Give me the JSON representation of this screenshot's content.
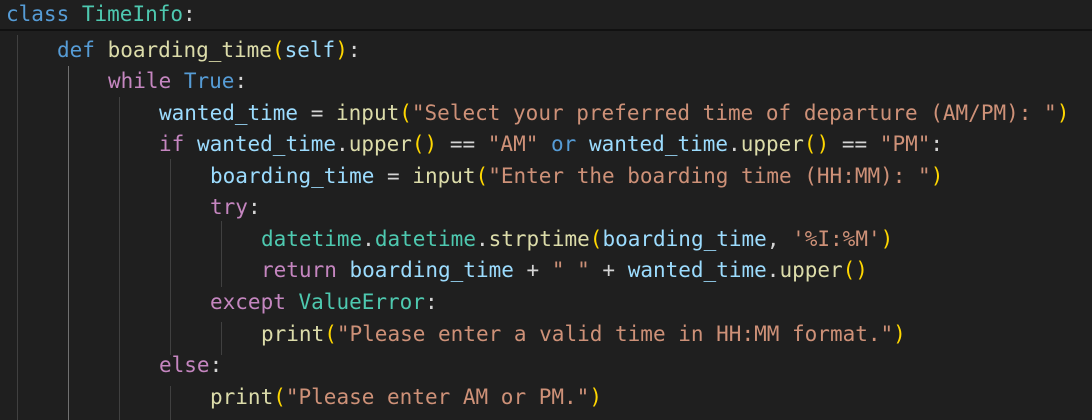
{
  "editor": {
    "code": {
      "l1": {
        "kw": "class",
        "name": "TimeInfo",
        "colon": ":"
      },
      "l2": {
        "kw": "def",
        "fname": "boarding_time",
        "p1": "(",
        "self": "self",
        "p2": ")",
        "colon": ":"
      },
      "l3": {
        "kw": "while",
        "val": "True",
        "colon": ":"
      },
      "l4": {
        "var": "wanted_time",
        "eq": " = ",
        "fn": "input",
        "p1": "(",
        "str": "\"Select your preferred time of departure (AM/PM): \"",
        "p2": ")"
      },
      "l5": {
        "kw": "if",
        "var1": "wanted_time",
        "dot1": ".",
        "m1": "upper",
        "p1": "()",
        "eq1": " == ",
        "s1": "\"AM\"",
        "or": "or",
        "var2": "wanted_time",
        "dot2": ".",
        "m2": "upper",
        "p2": "()",
        "eq2": " == ",
        "s2": "\"PM\"",
        "colon": ":"
      },
      "l6": {
        "var": "boarding_time",
        "eq": " = ",
        "fn": "input",
        "p1": "(",
        "str": "\"Enter the boarding time (HH:MM): \"",
        "p2": ")"
      },
      "l7": {
        "kw": "try",
        "colon": ":"
      },
      "l8": {
        "mod": "datetime",
        "dot1": ".",
        "cls": "datetime",
        "dot2": ".",
        "fn": "strptime",
        "p1": "(",
        "arg": "boarding_time",
        "comma": ", ",
        "str": "'%I:%M'",
        "p2": ")"
      },
      "l9": {
        "kw": "return",
        "var1": "boarding_time",
        "plus1": " + ",
        "s": "\" \"",
        "plus2": " + ",
        "var2": "wanted_time",
        "dot": ".",
        "m": "upper",
        "p": "()"
      },
      "l10": {
        "kw": "except",
        "exc": "ValueError",
        "colon": ":"
      },
      "l11": {
        "fn": "print",
        "p1": "(",
        "str": "\"Please enter a valid time in HH:MM format.\"",
        "p2": ")"
      },
      "l12": {
        "kw": "else",
        "colon": ":"
      },
      "l13": {
        "fn": "print",
        "p1": "(",
        "str": "\"Please enter AM or PM.\"",
        "p2": ")"
      }
    },
    "colors": {
      "background": "#1f1f1f",
      "keyword": "#569cd6",
      "control": "#c586c0",
      "class": "#4ec9b0",
      "function": "#dcdcaa",
      "variable": "#9cdcfe",
      "string": "#ce9178",
      "bracket_level1": "#ffd700",
      "bracket_level2": "#da70d6",
      "bracket_level3": "#179fff"
    }
  }
}
